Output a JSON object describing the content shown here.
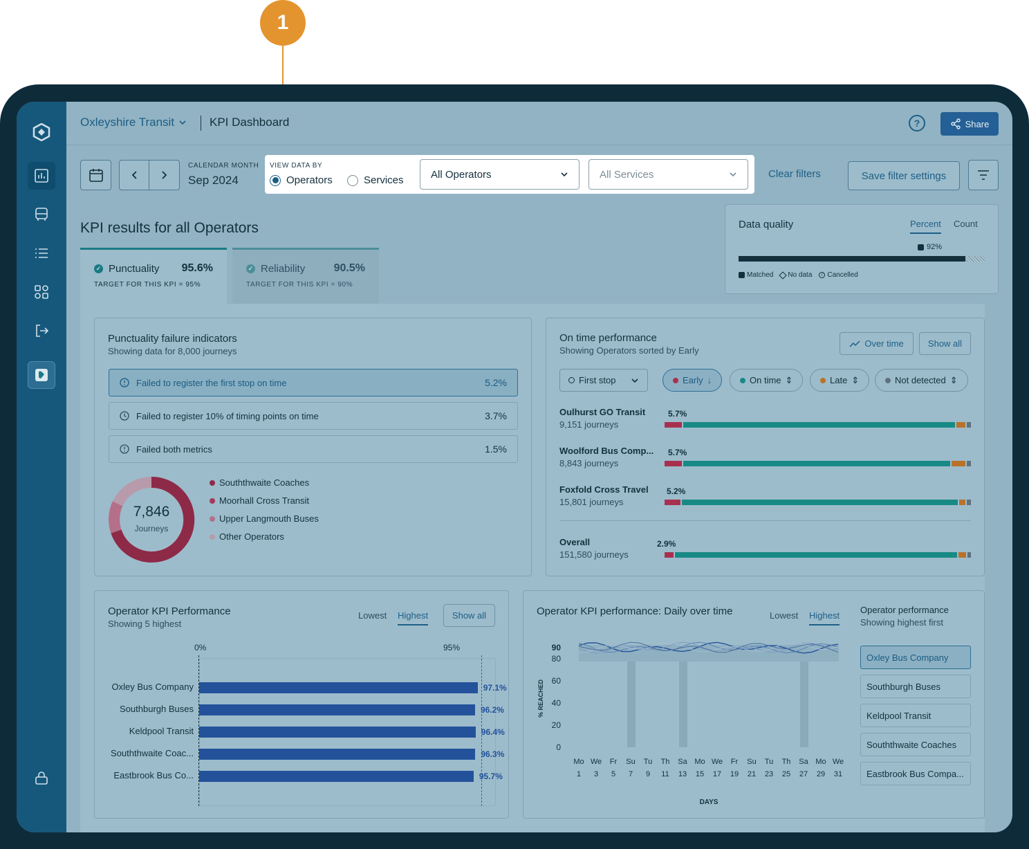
{
  "callout": {
    "number": "1"
  },
  "header": {
    "brand": "Oxleyshire Transit",
    "page_title": "KPI Dashboard",
    "help_symbol": "?",
    "share_label": "Share"
  },
  "filters": {
    "calendar_label": "CALENDAR MONTH",
    "calendar_value": "Sep 2024",
    "view_by_label": "VIEW DATA BY",
    "option_operators": "Operators",
    "option_services": "Services",
    "operators_select": "All Operators",
    "services_select": "All Services",
    "clear_filters": "Clear filters",
    "save_filters": "Save filter settings"
  },
  "kpi": {
    "title": "KPI results for all Operators",
    "tabs": [
      {
        "label": "Punctuality",
        "value": "95.6%",
        "target": "TARGET FOR THIS KPI = 95%"
      },
      {
        "label": "Reliability",
        "value": "90.5%",
        "target": "TARGET FOR THIS KPI = 90%"
      }
    ]
  },
  "data_quality": {
    "title": "Data quality",
    "tab_percent": "Percent",
    "tab_count": "Count",
    "matched_pct_label": "92%",
    "matched_fraction": 0.92,
    "legend_matched": "Matched",
    "legend_no_data": "No data",
    "legend_cancelled": "Cancelled"
  },
  "punctuality_failures": {
    "title": "Punctuality failure indicators",
    "subtitle": "Showing data for 8,000 journeys",
    "rows": [
      {
        "label": "Failed to register the first stop on time",
        "value": "5.2%"
      },
      {
        "label": "Failed to register 10% of timing points on time",
        "value": "3.7%"
      },
      {
        "label": "Failed both metrics",
        "value": "1.5%"
      }
    ],
    "donut_value": "7,846",
    "donut_label": "Journeys",
    "legend": [
      {
        "label": "Souththwaite Coaches",
        "color": "#8d2a48"
      },
      {
        "label": "Moorhall Cross Transit",
        "color": "#a33a58"
      },
      {
        "label": "Upper Langmouth Buses",
        "color": "#b47089"
      },
      {
        "label": "Other Operators",
        "color": "#b79bab"
      }
    ]
  },
  "on_time": {
    "title": "On time performance",
    "subtitle": "Showing Operators sorted by Early",
    "over_time": "Over time",
    "show_all": "Show all",
    "stop_select": "First stop",
    "chips": [
      {
        "label": "Early",
        "color": "#a8304f"
      },
      {
        "label": "On time",
        "color": "#178a86"
      },
      {
        "label": "Late",
        "color": "#b8722a"
      },
      {
        "label": "Not detected",
        "color": "#5d7180"
      }
    ],
    "operators": [
      {
        "name": "Oulhurst GO Transit",
        "journeys": "9,151 journeys",
        "early_label": "5.7%",
        "early": 5.7,
        "on_time": 89.0,
        "late": 3.5,
        "nd": 1.8
      },
      {
        "name": "Woolford Bus Comp...",
        "journeys": "8,843 journeys",
        "early_label": "5.7%",
        "early": 5.7,
        "on_time": 87.5,
        "late": 5.0,
        "nd": 1.8
      },
      {
        "name": "Foxfold Cross Travel",
        "journeys": "15,801 journeys",
        "early_label": "5.2%",
        "early": 5.2,
        "on_time": 90.5,
        "late": 2.5,
        "nd": 1.8
      }
    ],
    "overall": {
      "name": "Overall",
      "journeys": "151,580 journeys",
      "early_label": "2.9%",
      "early": 2.9,
      "on_time": 92.5,
      "late": 3.0,
      "nd": 1.6
    }
  },
  "operator_kpi": {
    "title": "Operator KPI Performance",
    "subtitle": "Showing 5 highest",
    "lowest": "Lowest",
    "highest": "Highest",
    "show_all": "Show all",
    "axis_zero": "0%",
    "axis_target": "95%",
    "bars": [
      {
        "name": "Oxley Bus Company",
        "value": 97.1,
        "label": "97.1%"
      },
      {
        "name": "Southburgh Buses",
        "value": 96.2,
        "label": "96.2%"
      },
      {
        "name": "Keldpool Transit",
        "value": 96.4,
        "label": "96.4%"
      },
      {
        "name": "Souththwaite Coac...",
        "value": 96.3,
        "label": "96.3%"
      },
      {
        "name": "Eastbrook Bus Co...",
        "value": 95.7,
        "label": "95.7%"
      }
    ]
  },
  "daily_kpi": {
    "title": "Operator KPI performance: Daily over time",
    "lowest": "Lowest",
    "highest": "Highest",
    "y_axis_label": "% REACHED",
    "x_axis_label": "DAYS",
    "y_ticks": [
      "90",
      "80",
      "60",
      "40",
      "20",
      "0"
    ],
    "days": [
      "Mo",
      "We",
      "Fr",
      "Su",
      "Tu",
      "Th",
      "Sa",
      "Mo",
      "We",
      "Fr",
      "Su",
      "Tu",
      "Th",
      "Sa",
      "Mo",
      "We"
    ],
    "dates": [
      "1",
      "3",
      "5",
      "7",
      "9",
      "11",
      "13",
      "15",
      "17",
      "19",
      "21",
      "23",
      "25",
      "27",
      "29",
      "31"
    ],
    "perf_title": "Operator performance",
    "perf_sub": "Showing highest first",
    "perf_items": [
      "Oxley Bus Company",
      "Southburgh Buses",
      "Keldpool Transit",
      "Souththwaite Coaches",
      "Eastbrook Bus Compa..."
    ]
  }
}
